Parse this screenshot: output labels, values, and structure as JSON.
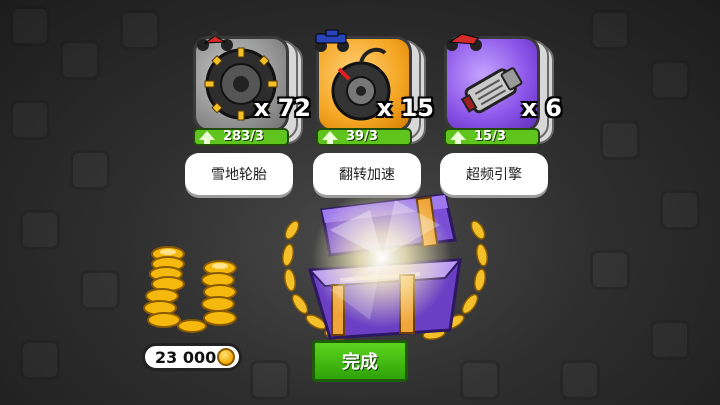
{
  "rewards": [
    {
      "name": "雪地轮胎",
      "count": "x 72",
      "progress_text": "283/3",
      "progress_fraction": 1.0,
      "icon": "snow-tire-icon",
      "vehicle": "motorbike-icon",
      "frame": "gray"
    },
    {
      "name": "翻转加速",
      "count": "x 15",
      "progress_text": "39/3",
      "progress_fraction": 1.0,
      "icon": "flip-boost-wheel-icon",
      "vehicle": "monster-truck-icon",
      "frame": "orange"
    },
    {
      "name": "超频引擎",
      "count": "x 6",
      "progress_text": "15/3",
      "progress_fraction": 1.0,
      "icon": "overclocked-engine-icon",
      "vehicle": "sport-bike-icon",
      "frame": "purple"
    }
  ],
  "coins": {
    "amount": "23 000",
    "icon": "coin-icon"
  },
  "done_button": {
    "label": "完成"
  },
  "colors": {
    "progress_green": "#5fc41e",
    "done_green": "#3cc014",
    "chest_purple": "#7a4fd6",
    "laurel_gold": "#f3c02a"
  }
}
